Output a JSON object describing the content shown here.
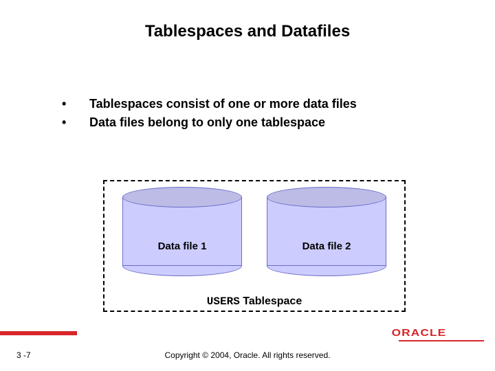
{
  "title": "Tablespaces and Datafiles",
  "bullets": [
    "Tablespaces consist of one or more data files",
    "Data files belong to only one tablespace"
  ],
  "diagram": {
    "datafile1_label": "Data file 1",
    "datafile2_label": "Data file 2",
    "tablespace_name": "USERS",
    "tablespace_word": "Tablespace"
  },
  "footer": {
    "page": "3 -7",
    "copyright": "Copyright © 2004, Oracle. All rights reserved.",
    "logo_text": "ORACLE"
  }
}
